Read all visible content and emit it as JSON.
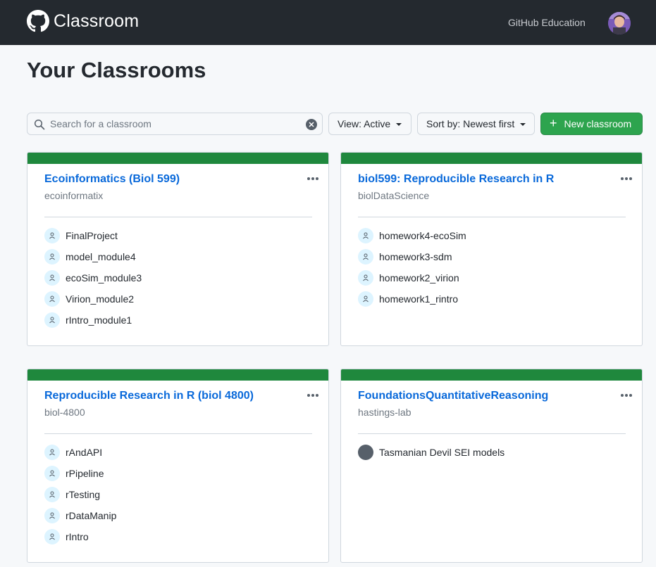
{
  "header": {
    "logo_text": "Classroom",
    "github_education": "GitHub Education"
  },
  "page_title": "Your Classrooms",
  "toolbar": {
    "search_placeholder": "Search for a classroom",
    "view_label": "View: Active",
    "sort_label": "Sort by: Newest first",
    "new_label": "New classroom"
  },
  "classrooms": [
    {
      "title": "Ecoinformatics (Biol 599)",
      "org": "ecoinformatix",
      "assignments": [
        "FinalProject",
        "model_module4",
        "ecoSim_module3",
        "Virion_module2",
        "rIntro_module1"
      ]
    },
    {
      "title": "biol599: Reproducible Research in R",
      "org": "biolDataScience",
      "assignments": [
        "homework4-ecoSim",
        "homework3-sdm",
        "homework2_virion",
        "homework1_rintro"
      ]
    },
    {
      "title": "Reproducible Research in R (biol 4800)",
      "org": "biol-4800",
      "assignments": [
        "rAndAPI",
        "rPipeline",
        "rTesting",
        "rDataManip",
        "rIntro"
      ]
    },
    {
      "title": "FoundationsQuantitativeReasoning",
      "org": "hastings-lab",
      "assignments": [
        "Tasmanian Devil SEI models"
      ]
    }
  ],
  "colors": {
    "topbar": "#24292f",
    "accent_green": "#2da44e",
    "card_bar": "#1f883d",
    "link": "#0969da"
  }
}
